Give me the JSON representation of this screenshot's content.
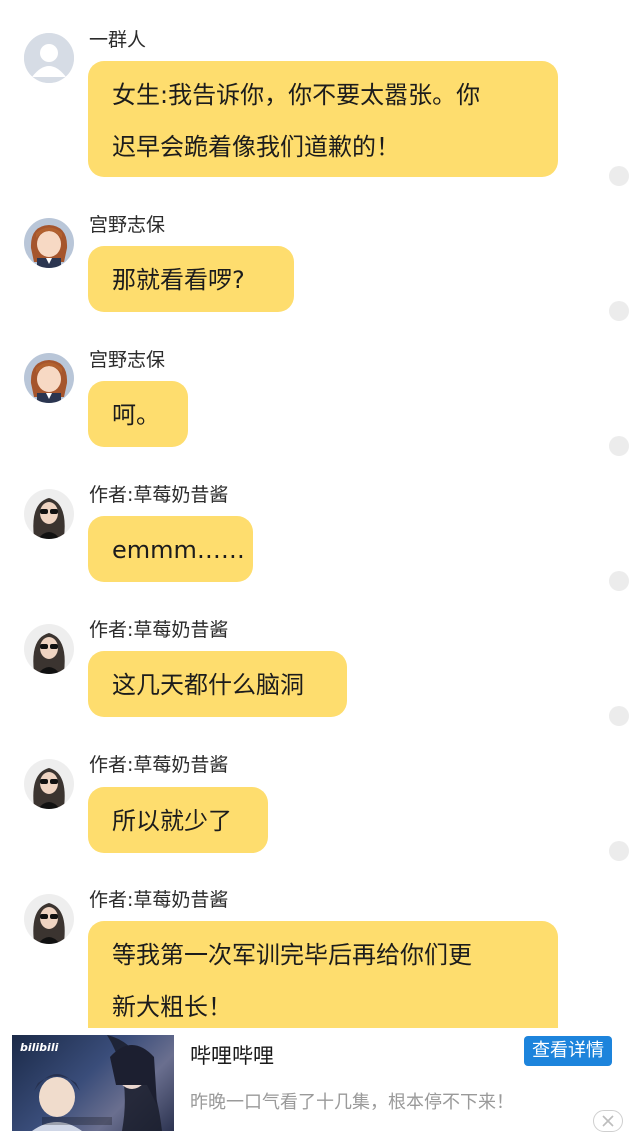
{
  "messages": [
    {
      "sender": "一群人",
      "avatar": "placeholder-person-icon",
      "lines": [
        "女生:我告诉你，你不要太嚣张。你",
        "迟早会跪着像我们道歉的！"
      ]
    },
    {
      "sender": "宫野志保",
      "avatar": "anime-girl-avatar",
      "lines": [
        "那就看看啰?"
      ]
    },
    {
      "sender": "宫野志保",
      "avatar": "anime-girl-avatar",
      "lines": [
        "呵。"
      ]
    },
    {
      "sender": "作者:草莓奶昔酱",
      "avatar": "sunglasses-woman-avatar",
      "lines": [
        "emmm……"
      ]
    },
    {
      "sender": "作者:草莓奶昔酱",
      "avatar": "sunglasses-woman-avatar",
      "lines": [
        "这几天都什么脑洞"
      ]
    },
    {
      "sender": "作者:草莓奶昔酱",
      "avatar": "sunglasses-woman-avatar",
      "lines": [
        "所以就少了"
      ]
    },
    {
      "sender": "作者:草莓奶昔酱",
      "avatar": "sunglasses-woman-avatar",
      "lines": [
        "等我第一次军训完毕后再给你们更",
        "新大粗长！"
      ]
    }
  ],
  "ad": {
    "logo": "bilibili",
    "title": "哔哩哔哩",
    "button": "查看详情",
    "description": "昨晚一口气看了十几集，根本停不下来！",
    "close_icon": "close-icon"
  },
  "colors": {
    "bubble": "#fedd6e",
    "ad_button": "#1d84dc"
  }
}
